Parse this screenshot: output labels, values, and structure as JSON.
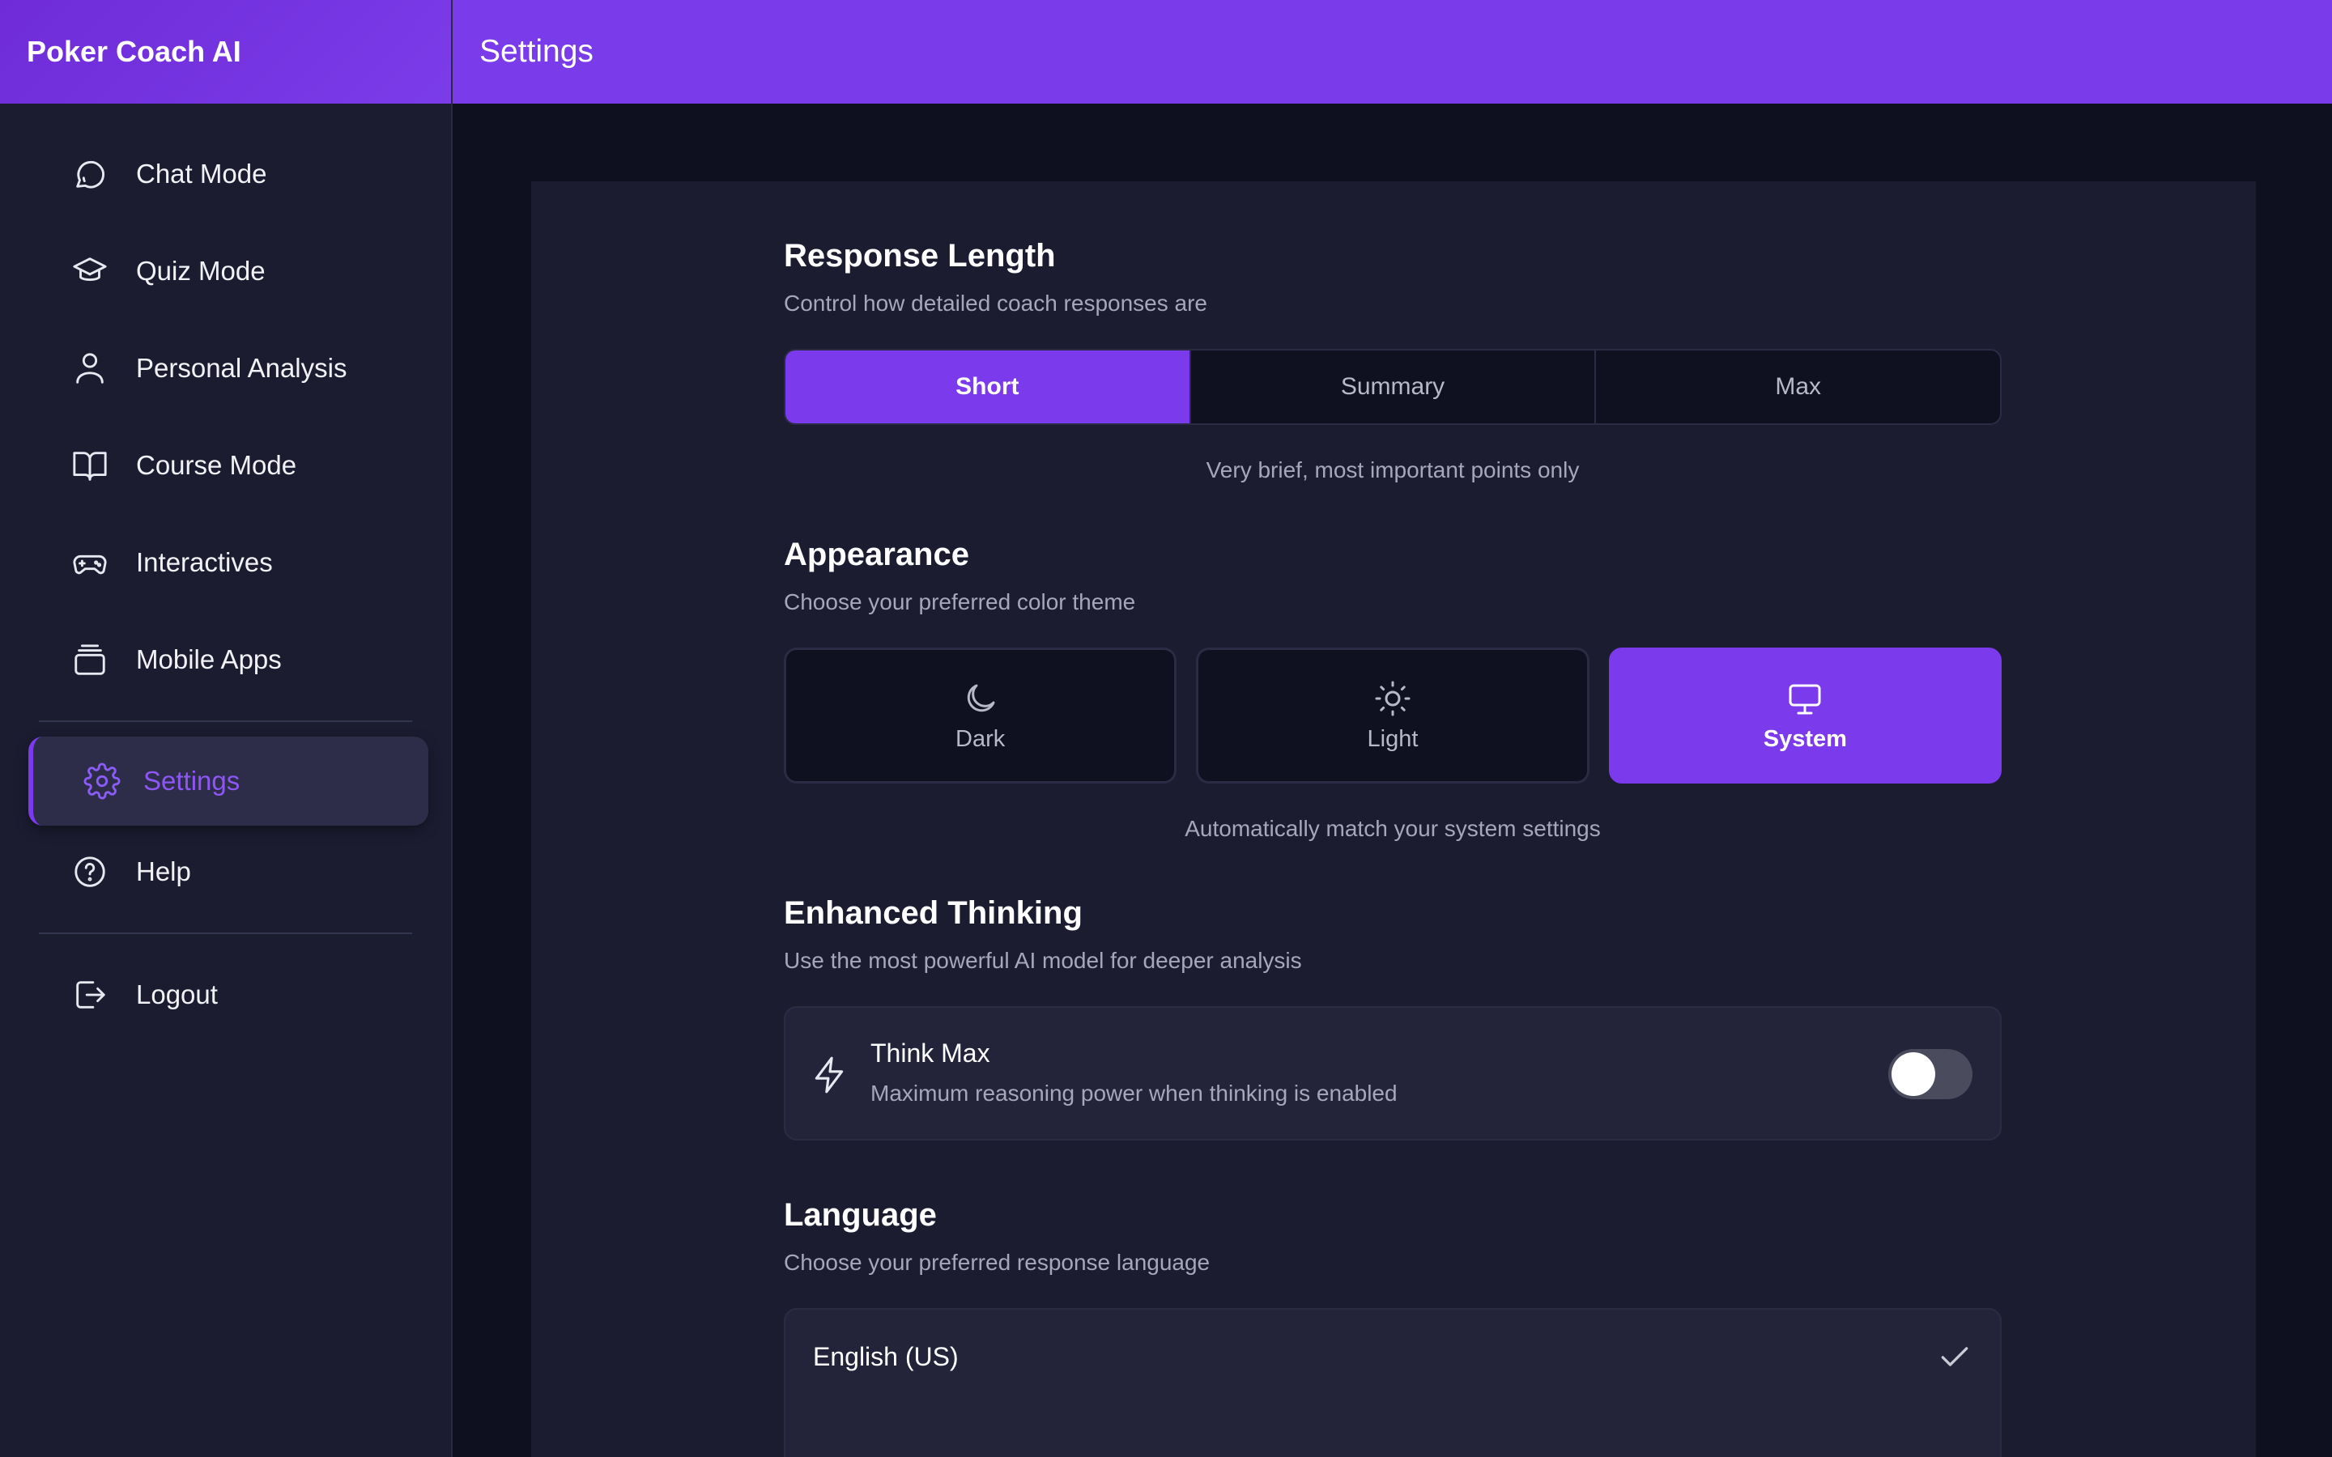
{
  "app": {
    "title": "Poker Coach AI"
  },
  "header": {
    "title": "Settings"
  },
  "sidebar": {
    "items": [
      {
        "label": "Chat Mode",
        "icon": "chat-bubble-icon"
      },
      {
        "label": "Quiz Mode",
        "icon": "graduation-cap-icon"
      },
      {
        "label": "Personal Analysis",
        "icon": "user-icon"
      },
      {
        "label": "Course Mode",
        "icon": "book-open-icon"
      },
      {
        "label": "Interactives",
        "icon": "gamepad-icon"
      },
      {
        "label": "Mobile Apps",
        "icon": "stacked-cards-icon"
      }
    ],
    "active": {
      "label": "Settings",
      "icon": "gear-icon"
    },
    "help": {
      "label": "Help",
      "icon": "question-circle-icon"
    },
    "logout": {
      "label": "Logout",
      "icon": "logout-icon"
    }
  },
  "response_length": {
    "title": "Response Length",
    "description": "Control how detailed coach responses are",
    "options": [
      "Short",
      "Summary",
      "Max"
    ],
    "selected": "Short",
    "hint": "Very brief, most important points only"
  },
  "appearance": {
    "title": "Appearance",
    "description": "Choose your preferred color theme",
    "options": [
      {
        "label": "Dark",
        "icon": "moon-icon"
      },
      {
        "label": "Light",
        "icon": "sun-icon"
      },
      {
        "label": "System",
        "icon": "monitor-icon"
      }
    ],
    "selected": "System",
    "hint": "Automatically match your system settings"
  },
  "enhanced_thinking": {
    "title": "Enhanced Thinking",
    "description": "Use the most powerful AI model for deeper analysis",
    "toggle_title": "Think Max",
    "toggle_description": "Maximum reasoning power when thinking is enabled",
    "enabled": false
  },
  "language": {
    "title": "Language",
    "description": "Choose your preferred response language",
    "selected": "English (US)"
  },
  "colors": {
    "accent": "#7c3aed",
    "sidebar_bg": "#1b1c30",
    "main_bg": "#0e0f1f"
  }
}
